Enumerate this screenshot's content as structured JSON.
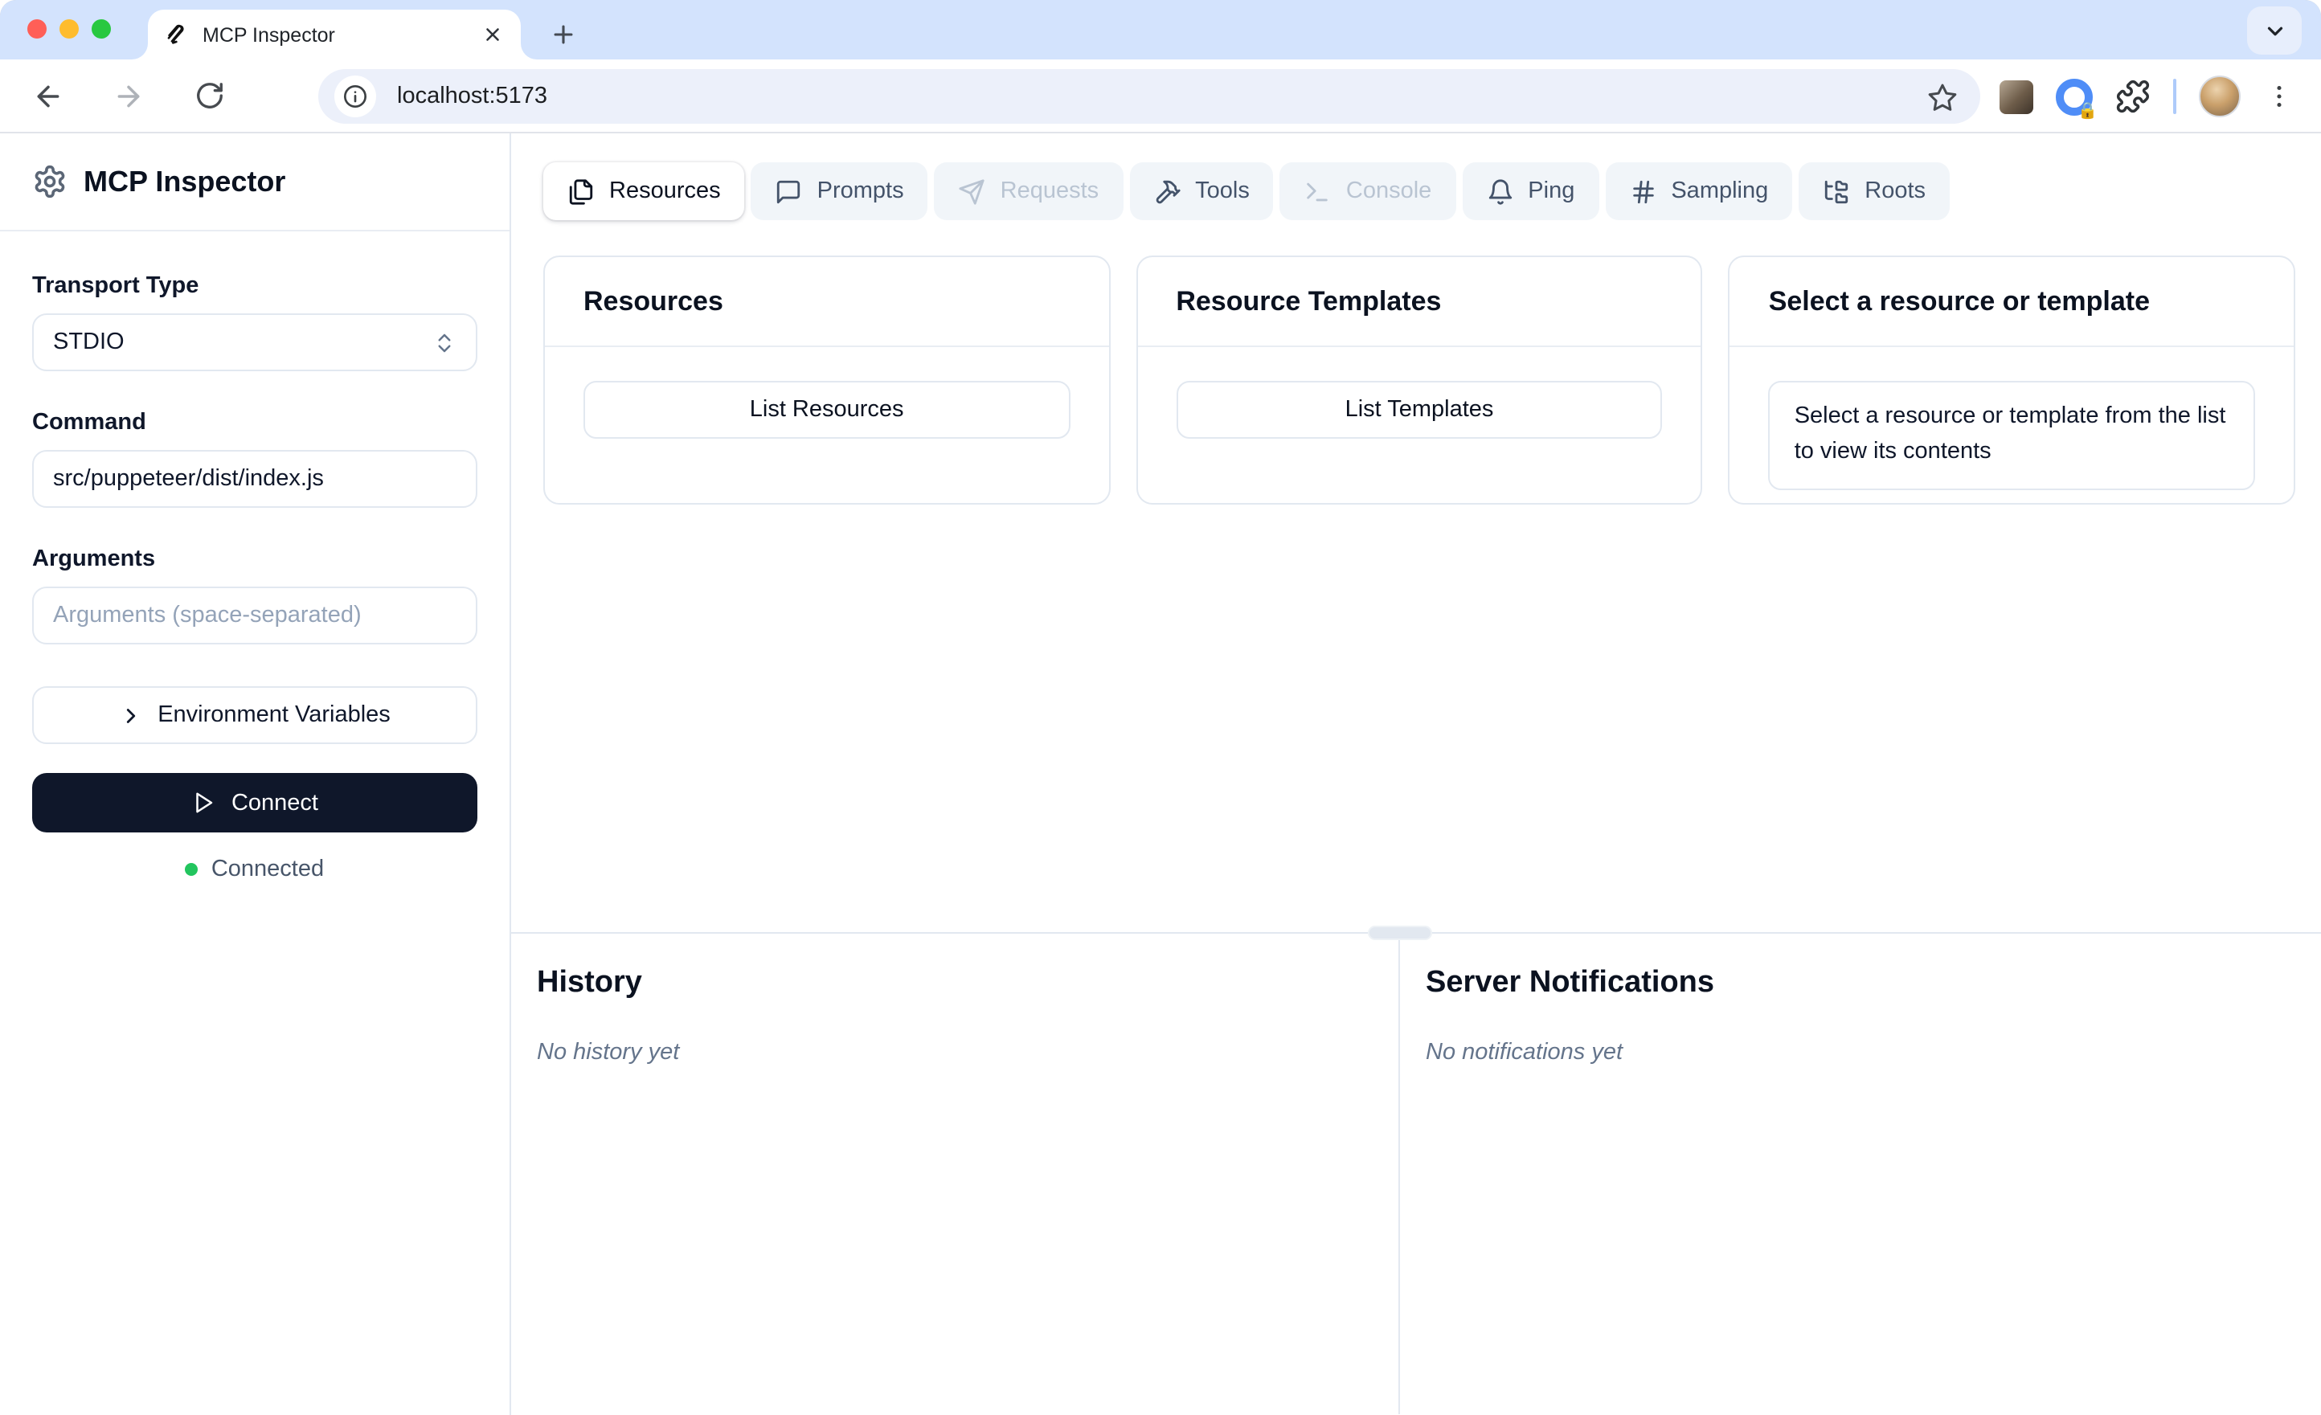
{
  "browser": {
    "tab_title": "MCP Inspector",
    "url": "localhost:5173"
  },
  "sidebar": {
    "title": "MCP Inspector",
    "transport_label": "Transport Type",
    "transport_value": "STDIO",
    "command_label": "Command",
    "command_value": "src/puppeteer/dist/index.js",
    "arguments_label": "Arguments",
    "arguments_placeholder": "Arguments (space-separated)",
    "env_button_label": "Environment Variables",
    "connect_button_label": "Connect",
    "status_text": "Connected"
  },
  "tabs": [
    {
      "label": "Resources",
      "icon": "files-icon",
      "state": "active"
    },
    {
      "label": "Prompts",
      "icon": "message-square-icon",
      "state": "enabled"
    },
    {
      "label": "Requests",
      "icon": "send-icon",
      "state": "disabled"
    },
    {
      "label": "Tools",
      "icon": "hammer-icon",
      "state": "enabled"
    },
    {
      "label": "Console",
      "icon": "terminal-icon",
      "state": "disabled"
    },
    {
      "label": "Ping",
      "icon": "bell-icon",
      "state": "enabled"
    },
    {
      "label": "Sampling",
      "icon": "hash-icon",
      "state": "enabled"
    },
    {
      "label": "Roots",
      "icon": "folder-tree-icon",
      "state": "enabled"
    }
  ],
  "panels": {
    "resources": {
      "title": "Resources",
      "button_label": "List Resources"
    },
    "templates": {
      "title": "Resource Templates",
      "button_label": "List Templates"
    },
    "preview": {
      "title": "Select a resource or template",
      "body": "Select a resource or template from the list to view its contents"
    }
  },
  "bottom": {
    "history_title": "History",
    "history_empty": "No history yet",
    "notifications_title": "Server Notifications",
    "notifications_empty": "No notifications yet"
  },
  "colors": {
    "connect_button_bg": "#0f172a",
    "status_green": "#22c55e",
    "tabstrip_bg": "#d3e3fd",
    "omnibox_bg": "#ecf0fa",
    "border": "#e2e8f0",
    "inactive_tab_bg": "#f1f5f9",
    "disabled_text": "#b9c4d2",
    "placeholder_text": "#94a3b8"
  }
}
